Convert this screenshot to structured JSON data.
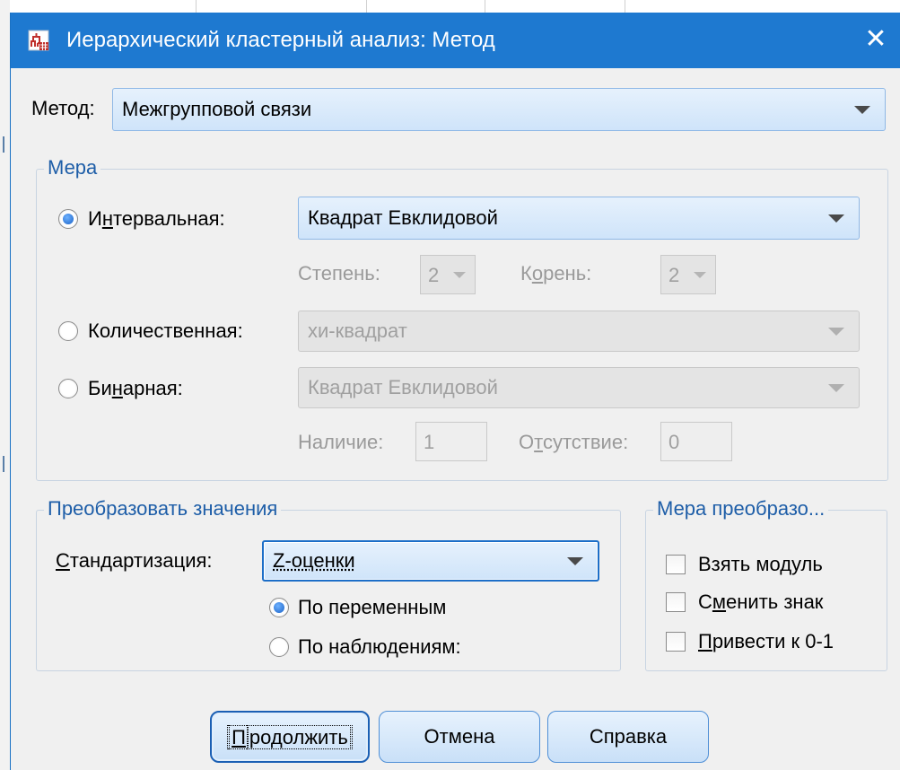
{
  "window": {
    "title": "Иерархический кластерный анализ: Метод",
    "close_glyph": "✕"
  },
  "method": {
    "label": "Метод:",
    "value": "Межгрупповой связи"
  },
  "measure": {
    "group_title": "Мера",
    "interval": {
      "label_pre": "И",
      "label_u": "н",
      "label_post": "тервальная:",
      "value": "Квадрат Евклидовой",
      "power_label": "Степень:",
      "power_value": "2",
      "root_label_pre": "К",
      "root_label_u": "о",
      "root_label_post": "рень:",
      "root_value": "2"
    },
    "counts": {
      "label": "Количественная:",
      "value": "хи-квадрат"
    },
    "binary": {
      "label_pre": "Би",
      "label_u": "н",
      "label_post": "арная:",
      "value": "Квадрат Евклидовой",
      "present_label": "Наличие:",
      "present_value": "1",
      "absent_label_pre": "О",
      "absent_label_u": "т",
      "absent_label_post": "сутствие:",
      "absent_value": "0"
    },
    "selected": "interval"
  },
  "transform_values": {
    "group_title": "Преобразовать значения",
    "standardize_label_u": "С",
    "standardize_label_post": "тандартизация:",
    "standardize_value": "Z-оценки",
    "by_variable": "По переменным",
    "by_case": "По наблюдениям:",
    "selected": "by_variable"
  },
  "transform_measures": {
    "group_title": "Мера преобразо...",
    "absolute": {
      "label": "Взять модуль",
      "checked": false
    },
    "change_sign": {
      "label_pre": "С",
      "label_u": "м",
      "label_post": "енить знак",
      "checked": false
    },
    "rescale": {
      "label_pre": "",
      "label_u": "П",
      "label_post": "ривести к 0-1",
      "checked": false
    }
  },
  "buttons": {
    "continue_u": "П",
    "continue_post": "родолжить",
    "cancel": "Отмена",
    "help": "Справка"
  },
  "colors": {
    "titlebar": "#1e79d0",
    "dialog_bg": "#f0f0f0",
    "group_title": "#1e5ea8",
    "button_border": "#4f8fd6"
  }
}
